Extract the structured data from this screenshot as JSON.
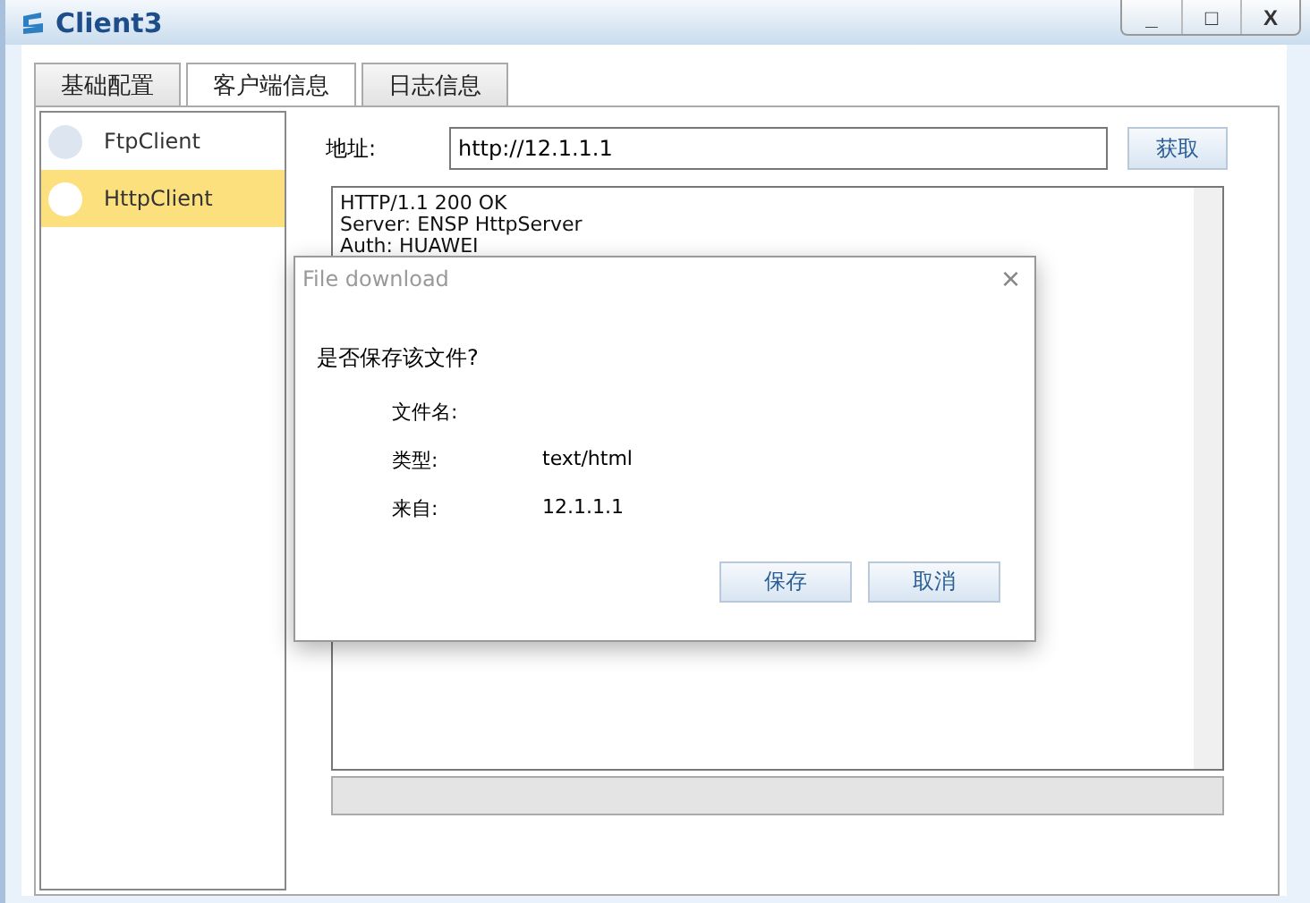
{
  "window": {
    "title": "Client3",
    "controls": [
      "_",
      "□",
      "X"
    ]
  },
  "tabs": [
    {
      "label": "基础配置",
      "selected": false
    },
    {
      "label": "客户端信息",
      "selected": true
    },
    {
      "label": "日志信息",
      "selected": false
    }
  ],
  "clients": [
    {
      "name": "FtpClient",
      "selected": false
    },
    {
      "name": "HttpClient",
      "selected": true
    }
  ],
  "address": {
    "label": "地址:",
    "value": "http://12.1.1.1",
    "button": "获取"
  },
  "response": [
    "HTTP/1.1 200 OK",
    "Server: ENSP HttpServer",
    "Auth: HUAWEI"
  ],
  "dialog": {
    "title": "File download",
    "close": "×",
    "question": "是否保存该文件?",
    "fields": [
      {
        "label": "文件名:"
      },
      {
        "label": "类型:",
        "value": "text/html"
      },
      {
        "label": "来自:",
        "value": "12.1.1.1"
      }
    ],
    "buttons": [
      "保存",
      "取消"
    ]
  }
}
